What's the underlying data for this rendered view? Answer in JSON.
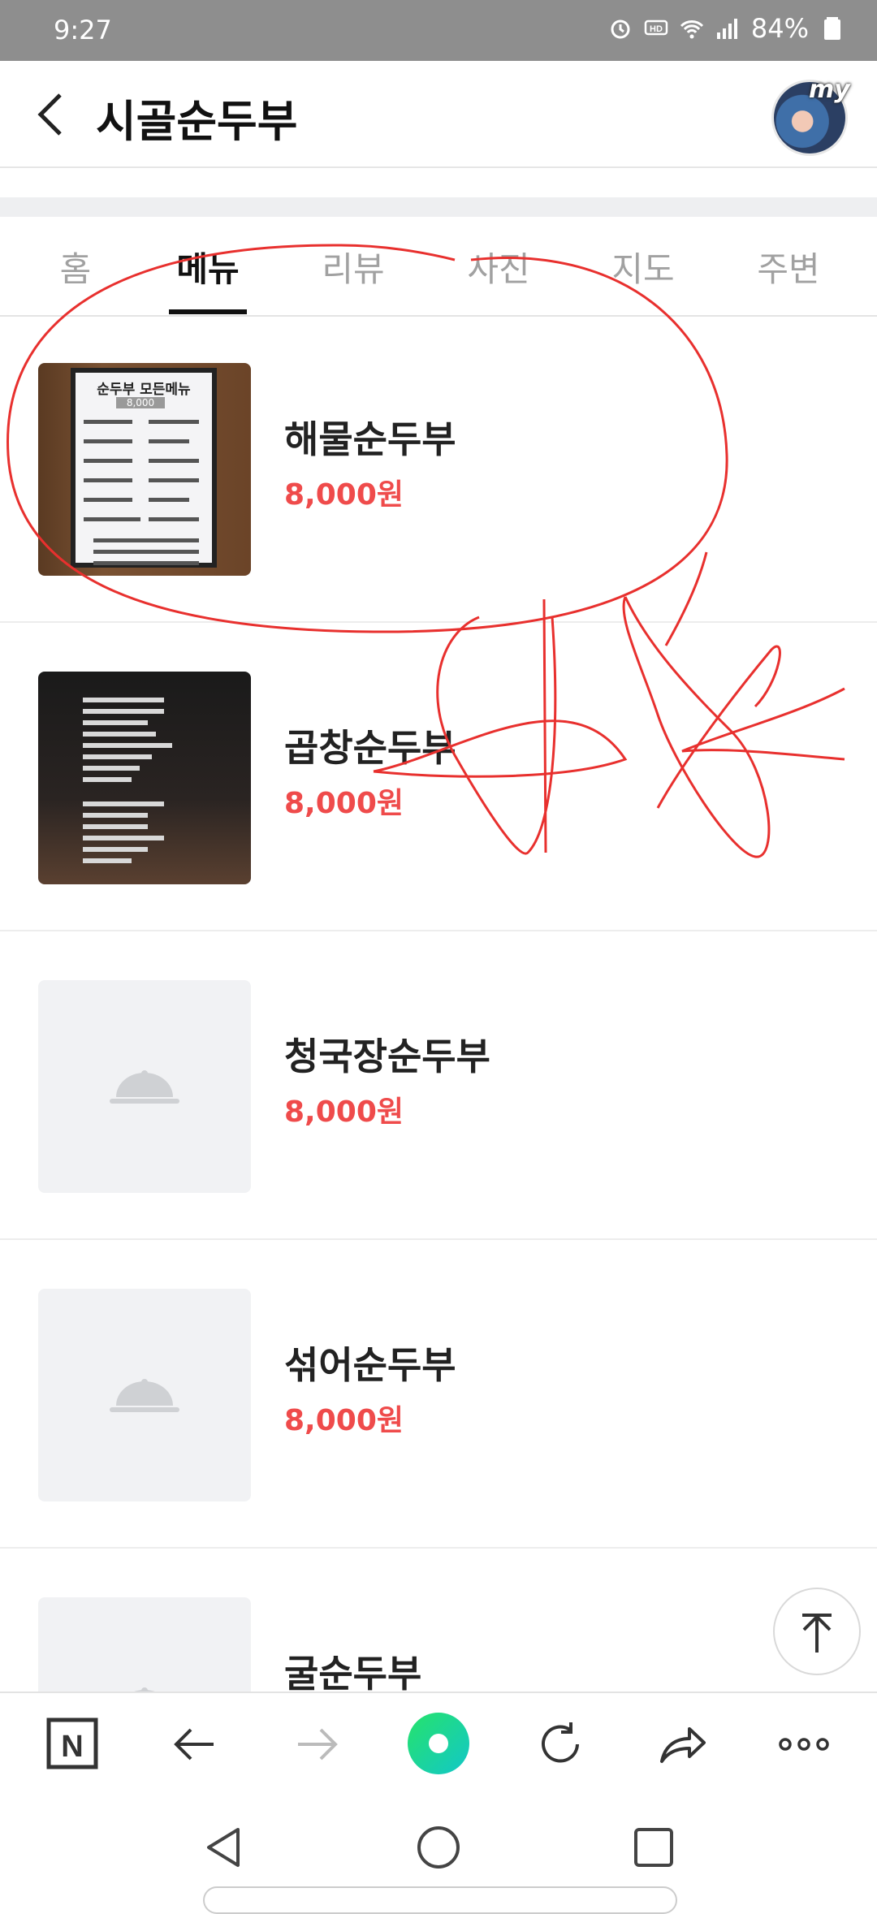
{
  "status_bar": {
    "time": "9:27",
    "battery": "84%"
  },
  "header": {
    "title": "시골순두부",
    "avatar_label": "my"
  },
  "tabs": [
    {
      "label": "홈",
      "active": false
    },
    {
      "label": "메뉴",
      "active": true
    },
    {
      "label": "리뷰",
      "active": false
    },
    {
      "label": "사진",
      "active": false
    },
    {
      "label": "지도",
      "active": false
    },
    {
      "label": "주변",
      "active": false
    }
  ],
  "menu_items": [
    {
      "name": "해물순두부",
      "price": "8,000원"
    },
    {
      "name": "곱창순두부",
      "price": "8,000원"
    },
    {
      "name": "청국장순두부",
      "price": "8,000원"
    },
    {
      "name": "섞어순두부",
      "price": "8,000원"
    },
    {
      "name": "굴순두부",
      "price": ""
    }
  ],
  "board_text": {
    "title": "순두부 모든메뉴",
    "price": "8,000"
  },
  "colors": {
    "accent_price": "#ef4b4b",
    "status_bar": "#8e8e8e",
    "scribble": "#e8302e",
    "naver_green": "#1ed67a"
  },
  "browser_bar": {
    "icons": [
      "naver-n-icon",
      "back-arrow-icon",
      "forward-arrow-icon",
      "green-home-icon",
      "reload-icon",
      "share-icon",
      "more-icon"
    ]
  },
  "nav_bar": {
    "icons": [
      "nav-back-icon",
      "nav-home-icon",
      "nav-recents-icon"
    ]
  }
}
